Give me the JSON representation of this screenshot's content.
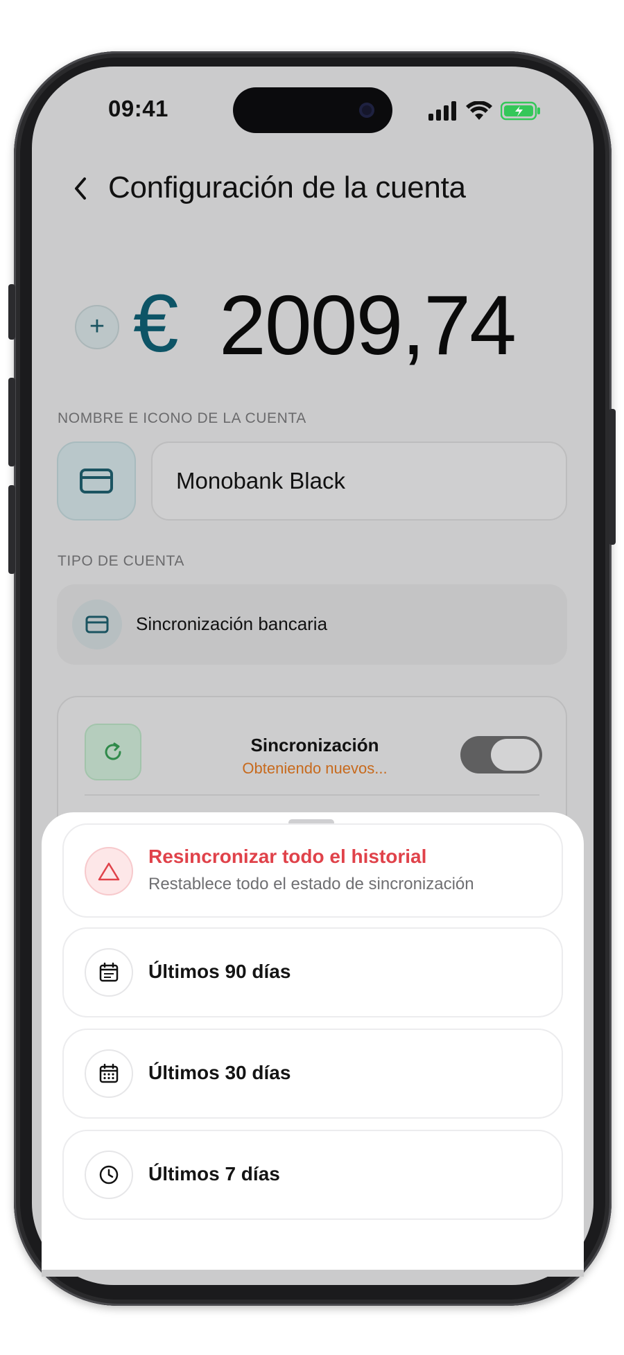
{
  "status_bar": {
    "time": "09:41"
  },
  "header": {
    "title": "Configuración de la cuenta"
  },
  "balance": {
    "currency_symbol": "€",
    "amount": "2009,74",
    "add_symbol": "+"
  },
  "account_name": {
    "section_label": "NOMBRE E ICONO DE LA CUENTA",
    "value": "Monobank Black",
    "icon": "credit-card-icon"
  },
  "account_type": {
    "section_label": "TIPO DE CUENTA",
    "value": "Sincronización bancaria",
    "icon": "credit-card-icon"
  },
  "sync": {
    "title": "Sincronización",
    "status": "Obteniendo nuevos...",
    "enabled": true,
    "icon": "refresh-icon"
  },
  "sheet": {
    "options": [
      {
        "label": "Resincronizar todo el historial",
        "description": "Restablece todo el estado de sincronización",
        "icon": "warning-triangle-icon",
        "danger": true
      },
      {
        "label": "Últimos 90 días",
        "icon": "calendar-icon"
      },
      {
        "label": "Últimos 30 días",
        "icon": "calendar-grid-icon"
      },
      {
        "label": "Últimos 7 días",
        "icon": "clock-icon"
      }
    ]
  },
  "colors": {
    "accent": "#0d5466",
    "danger": "#e0424a",
    "status_orange": "#c76a1d",
    "battery": "#34c759"
  }
}
